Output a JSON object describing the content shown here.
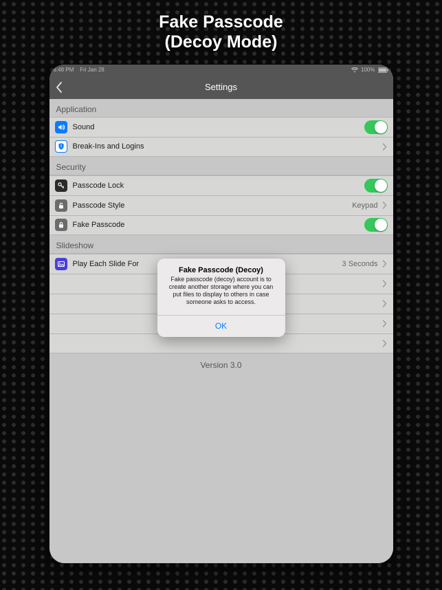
{
  "marketing": {
    "line1": "Fake Passcode",
    "line2": "(Decoy Mode)"
  },
  "status": {
    "time": "6:48 PM",
    "date": "Fri Jan 28",
    "battery": "100%"
  },
  "nav": {
    "title": "Settings"
  },
  "sections": {
    "application": {
      "header": "Application",
      "sound": {
        "label": "Sound",
        "on": true
      },
      "breakins": {
        "label": "Break-Ins and Logins"
      }
    },
    "security": {
      "header": "Security",
      "passcode_lock": {
        "label": "Passcode Lock",
        "on": true
      },
      "passcode_style": {
        "label": "Passcode Style",
        "value": "Keypad"
      },
      "fake_passcode": {
        "label": "Fake Passcode",
        "on": true
      }
    },
    "slideshow": {
      "header": "Slideshow",
      "play_each": {
        "label": "Play Each Slide For",
        "value": "3 Seconds"
      }
    }
  },
  "version": "Version 3.0",
  "alert": {
    "title": "Fake Passcode (Decoy)",
    "body": "Fake passcode (decoy) account is to create another storage where you can put files to display to others in case someone asks to access.",
    "ok": "OK"
  }
}
